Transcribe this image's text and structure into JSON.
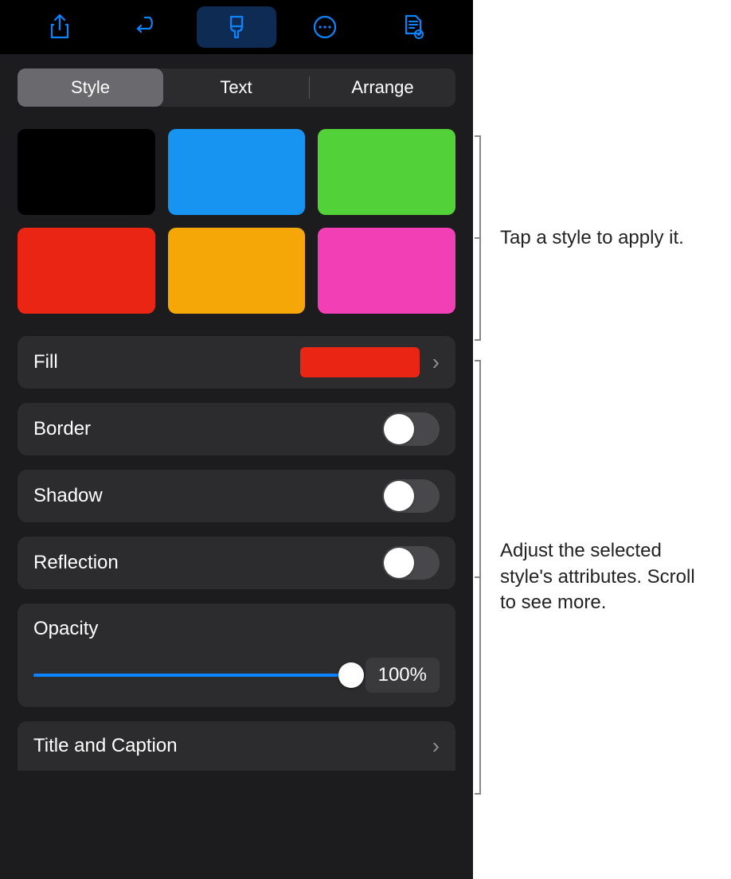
{
  "toolbar": {
    "icons": [
      "share-icon",
      "undo-icon",
      "format-brush-icon",
      "more-icon",
      "document-icon"
    ],
    "activeIndex": 2
  },
  "tabs": {
    "style": "Style",
    "text": "Text",
    "arrange": "Arrange",
    "selected": "style"
  },
  "swatches": [
    {
      "color": "#000000",
      "name": "black"
    },
    {
      "color": "#1793f2",
      "name": "blue"
    },
    {
      "color": "#52d238",
      "name": "green"
    },
    {
      "color": "#eb2513",
      "name": "red"
    },
    {
      "color": "#f6a708",
      "name": "orange"
    },
    {
      "color": "#f33fb6",
      "name": "pink"
    }
  ],
  "rows": {
    "fill": {
      "label": "Fill",
      "color": "#eb2513"
    },
    "border": {
      "label": "Border",
      "on": false
    },
    "shadow": {
      "label": "Shadow",
      "on": false
    },
    "reflection": {
      "label": "Reflection",
      "on": false
    },
    "opacity": {
      "label": "Opacity",
      "value": "100%",
      "percent": 100
    },
    "titleCaption": {
      "label": "Title and Caption"
    }
  },
  "callouts": {
    "swatches": "Tap a style to apply it.",
    "attributes": "Adjust the selected style's attributes. Scroll to see more."
  }
}
